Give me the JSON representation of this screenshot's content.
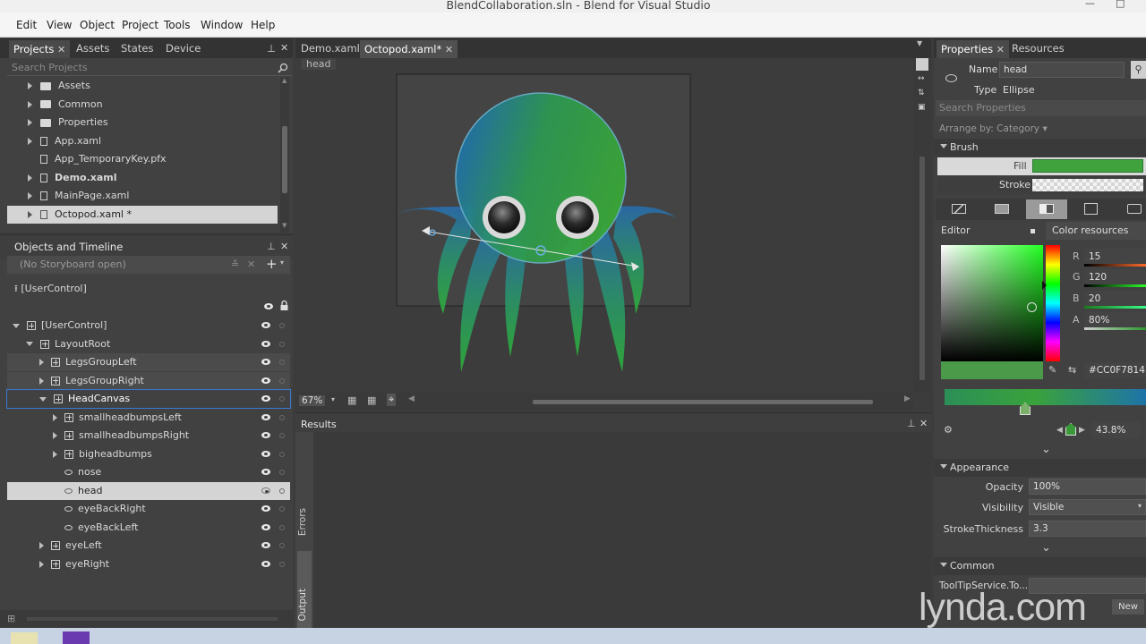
{
  "window": {
    "title": "BlendCollaboration.sln - Blend for Visual Studio"
  },
  "menu": [
    "Edit",
    "View",
    "Object",
    "Project",
    "Tools",
    "Window",
    "Help"
  ],
  "projects_panel": {
    "tabs": [
      "Projects",
      "Assets",
      "States",
      "Device"
    ],
    "search_placeholder": "Search Projects",
    "items": [
      {
        "label": "Assets",
        "kind": "folder",
        "expandable": true
      },
      {
        "label": "Common",
        "kind": "folder",
        "expandable": true
      },
      {
        "label": "Properties",
        "kind": "folder",
        "expandable": true
      },
      {
        "label": "App.xaml",
        "kind": "file",
        "expandable": true
      },
      {
        "label": "App_TemporaryKey.pfx",
        "kind": "file",
        "expandable": false
      },
      {
        "label": "Demo.xaml",
        "kind": "file",
        "expandable": true
      },
      {
        "label": "MainPage.xaml",
        "kind": "file",
        "expandable": true
      },
      {
        "label": "Octopod.xaml *",
        "kind": "file",
        "expandable": true
      }
    ]
  },
  "objects_panel": {
    "title": "Objects and Timeline",
    "storyboard": "(No Storyboard open)",
    "scope": "[UserControl]",
    "tree": [
      {
        "label": "[UserControl]",
        "depth": 0,
        "icon": "usercontrol",
        "toggle": "open"
      },
      {
        "label": "LayoutRoot",
        "depth": 1,
        "icon": "grid",
        "toggle": "open"
      },
      {
        "label": "LegsGroupLeft",
        "depth": 2,
        "icon": "grid",
        "toggle": "closed"
      },
      {
        "label": "LegsGroupRight",
        "depth": 2,
        "icon": "grid",
        "toggle": "closed"
      },
      {
        "label": "HeadCanvas",
        "depth": 2,
        "icon": "grid",
        "toggle": "open"
      },
      {
        "label": "smallheadbumpsLeft",
        "depth": 3,
        "icon": "grid",
        "toggle": "closed"
      },
      {
        "label": "smallheadbumpsRight",
        "depth": 3,
        "icon": "grid",
        "toggle": "closed"
      },
      {
        "label": "bigheadbumps",
        "depth": 3,
        "icon": "grid",
        "toggle": "closed"
      },
      {
        "label": "nose",
        "depth": 3,
        "icon": "ellipse",
        "toggle": "none"
      },
      {
        "label": "head",
        "depth": 3,
        "icon": "ellipse",
        "toggle": "none"
      },
      {
        "label": "eyeBackRight",
        "depth": 3,
        "icon": "ellipse",
        "toggle": "none"
      },
      {
        "label": "eyeBackLeft",
        "depth": 3,
        "icon": "ellipse",
        "toggle": "none"
      },
      {
        "label": "eyeLeft",
        "depth": 2,
        "icon": "grid",
        "toggle": "closed"
      },
      {
        "label": "eyeRight",
        "depth": 2,
        "icon": "grid",
        "toggle": "closed"
      }
    ]
  },
  "documents": {
    "tabs": [
      "Demo.xaml",
      "Octopod.xaml*"
    ],
    "breadcrumb": "head",
    "zoom": "67%"
  },
  "results": {
    "title": "Results",
    "side_tabs": [
      "Errors",
      "Output"
    ]
  },
  "properties": {
    "tabs": [
      "Properties",
      "Resources"
    ],
    "name_label": "Name",
    "name_value": "head",
    "type_label": "Type",
    "type_value": "Ellipse",
    "search_placeholder": "Search Properties",
    "arrange": "Arrange by: Category ▾",
    "brush_section": "Brush",
    "fill_label": "Fill",
    "stroke_label": "Stroke",
    "editor_label": "Editor",
    "color_resources_label": "Color resources",
    "r_label": "R",
    "r_value": "15",
    "g_label": "G",
    "g_value": "120",
    "b_label": "B",
    "b_value": "20",
    "a_label": "A",
    "a_value": "80%",
    "hex_value": "#CC0F7814",
    "gradient_offset": "43.8%",
    "gradient_stop_position": 0.4,
    "appearance_section": "Appearance",
    "opacity_label": "Opacity",
    "opacity_value": "100%",
    "visibility_label": "Visibility",
    "visibility_value": "Visible",
    "stroke_thickness_label": "StrokeThickness",
    "stroke_thickness_value": "3.3",
    "common_section": "Common",
    "tooltip_label": "ToolTipService.To...",
    "new_button": "New",
    "fill_color": "#3fa23c",
    "gradient_start": "#2b8f57",
    "gradient_end": "#1e74a8"
  },
  "watermark": "lynda.com",
  "colors": {
    "accent_selection": "#d4d4d4",
    "panel_bg": "#414141",
    "canvas_bg": "#3c3c3c",
    "octopus_green": "#3da537",
    "octopus_blue": "#2a6fb0"
  }
}
